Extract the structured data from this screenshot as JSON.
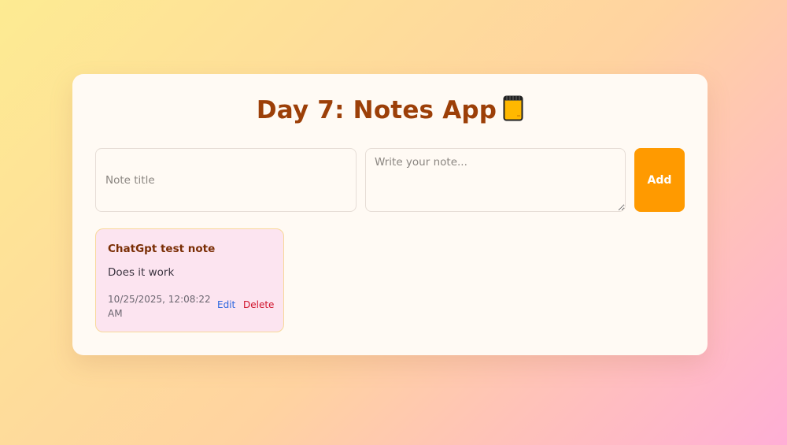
{
  "app": {
    "title": "Day 7: Notes App",
    "title_icon": "notepad-icon"
  },
  "form": {
    "title_placeholder": "Note title",
    "title_value": "",
    "body_placeholder": "Write your note...",
    "body_value": "",
    "add_label": "Add"
  },
  "notes": [
    {
      "title": "ChatGpt test note",
      "body": "Does it work",
      "timestamp": "10/25/2025, 12:08:22 AM",
      "edit_label": "Edit",
      "delete_label": "Delete"
    }
  ],
  "colors": {
    "accent": "#ff9a00",
    "title": "#9c3f08",
    "note_bg": "#fce4f0",
    "edit": "#2b66e0",
    "delete": "#d0122a"
  }
}
